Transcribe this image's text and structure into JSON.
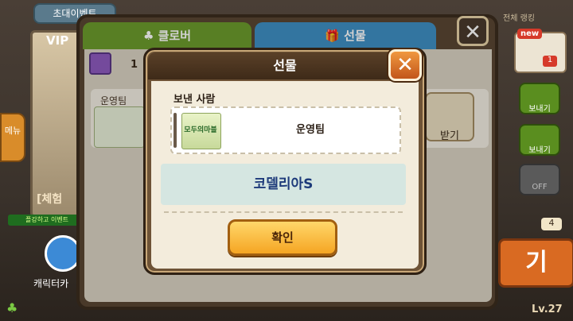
{
  "background": {
    "invite_label": "초대이벤트",
    "vip_label": "VIP",
    "menu_label": "메뉴",
    "trial_label": "[체험",
    "event_banner": "플강하고 이벤트",
    "character_label": "캐릭터카",
    "level_label": "Lv.27",
    "ranking_label": "전체 랭킹",
    "new_badge": "new",
    "mail_count": "1",
    "send_labels": [
      "보내기",
      "보내기"
    ],
    "off_label": "OFF",
    "key_count": "4",
    "big_button_label": "기"
  },
  "back_panel": {
    "tab_clover": "♣ 클로버",
    "tab_gift": "🎁 선물",
    "close_symbol": "✕",
    "gift_count": "1",
    "row_sender": "운영팀",
    "receive_label": "받기"
  },
  "modal": {
    "title": "선물",
    "close_symbol": "✕",
    "sender_heading": "보낸 사람",
    "sender_logo_text": "모두의마블",
    "sender_name": "운영팀",
    "item_name": "코델리아S",
    "confirm_label": "확인"
  },
  "colors": {
    "confirm_button": "#f5a523",
    "item_box": "#d5e6e1",
    "item_text": "#1d3a7a",
    "header": "#3e2a18"
  }
}
